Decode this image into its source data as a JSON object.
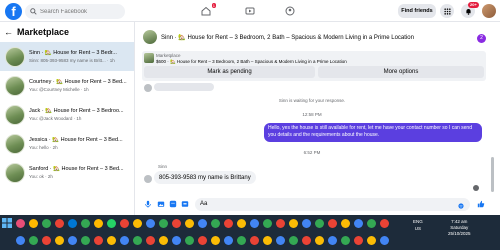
{
  "topbar": {
    "logo": "f",
    "search_placeholder": "Search Facebook",
    "nav_badge": "1",
    "find_friends": "Find friends",
    "notif_count": "20+"
  },
  "sidebar": {
    "title": "Marketplace",
    "conversations": [
      {
        "title": "Sinn · 🏡 House for Rent – 3 Bedr...",
        "sub": "Sinn: 805-393-9583 my name is Britt... · 1h",
        "active": true
      },
      {
        "title": "Courtney · 🏡 House for Rent – 3 Bed...",
        "sub": "You: @Courtney Michelle · 1h",
        "active": false
      },
      {
        "title": "Jack · 🏡 House for Rent – 3 Bedroo...",
        "sub": "You: @Jack Woodard · 1h",
        "active": false
      },
      {
        "title": "Jessica · 🏡 House for Rent – 3 Bed...",
        "sub": "You: hello · 2h",
        "active": false
      },
      {
        "title": "Sanford · 🏡 House for Rent – 3 Bed...",
        "sub": "You: ok · 2h",
        "active": false
      }
    ]
  },
  "chat": {
    "header_title": "Sinn · 🏡 House for Rent – 3 Bedroom, 2 Bath – Spacious & Modern Living in a Prime Location",
    "header_badge": "2",
    "marketplace_label": "Marketplace",
    "listing": "$600 · 🏡 House for Rent – 3 Bedroom, 2 Bath – Spacious & Modern Living in a Prime Location",
    "mark_pending": "Mark as pending",
    "more_options": "More options",
    "waiting": "Sinn is waiting for your response.",
    "time1": "12:58 PM",
    "sent_msg": "Hello, yes the house is still available for rent, let me have your contact number so I can send you details and the requirements about the house.",
    "time2": "6:52 PM",
    "sender": "Sinn",
    "reply": "805-393-9583 my name is Brittany",
    "composer_text": "Aa"
  },
  "taskbar": {
    "lang": "ENG",
    "region": "US",
    "time": "7:42 am",
    "day": "Saturday",
    "date": "25/10/2025"
  },
  "colors": {
    "accent": "#1877f2",
    "sent_bubble": "#5b3fe0",
    "taskbar": "#1d2b3a"
  }
}
